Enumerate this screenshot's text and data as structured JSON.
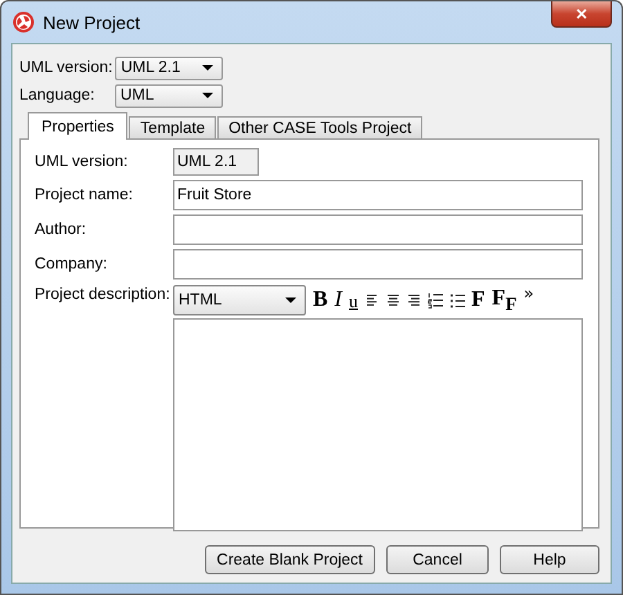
{
  "window": {
    "title": "New Project",
    "close": "✕"
  },
  "top_fields": [
    {
      "label": "UML version:",
      "value": "UML 2.1"
    },
    {
      "label": "Language:",
      "value": "UML"
    }
  ],
  "tabs": [
    {
      "label": "Properties",
      "selected": true
    },
    {
      "label": "Template",
      "selected": false
    },
    {
      "label": "Other CASE Tools Project",
      "selected": false
    }
  ],
  "properties": {
    "uml_version": {
      "label": "UML version:",
      "value": "UML 2.1"
    },
    "fields": [
      {
        "label": "Project name:",
        "value": "Fruit Store"
      },
      {
        "label": "Author:"
      },
      {
        "label": "Company:"
      }
    ],
    "description": {
      "label": "Project description:",
      "format": "HTML",
      "toolbar": [
        {
          "kind": "bold",
          "label": "B"
        },
        {
          "kind": "italic",
          "label": "I"
        },
        {
          "kind": "underline",
          "label": "u"
        },
        {
          "kind": "align-left"
        },
        {
          "kind": "align-center"
        },
        {
          "kind": "align-right"
        },
        {
          "kind": "numbered-list"
        },
        {
          "kind": "bullet-list"
        },
        {
          "kind": "font",
          "label": "F"
        },
        {
          "kind": "font-size",
          "label": "F$_{F}$"
        },
        {
          "kind": "more",
          "label": "»"
        }
      ]
    }
  },
  "buttons": [
    "Create Blank Project",
    "Cancel",
    "Help"
  ]
}
